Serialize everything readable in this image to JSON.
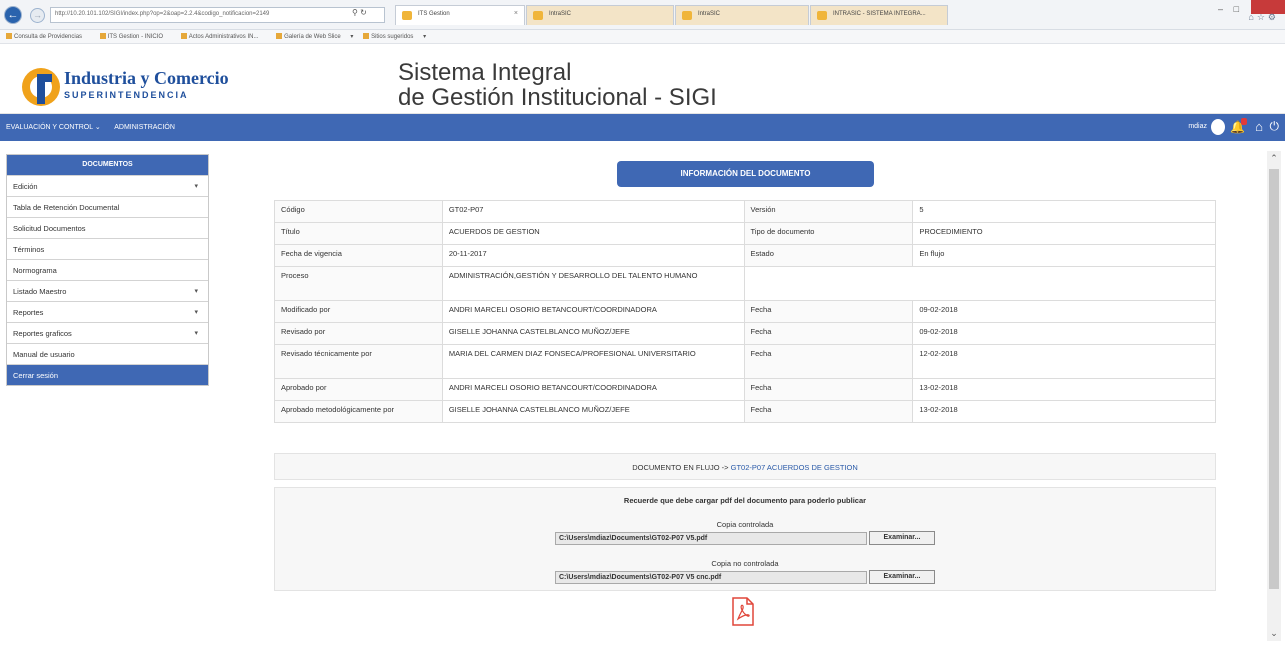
{
  "browser": {
    "url": "http://10.20.101.102/SIGI/index.php?op=2&oap=2.2.4&codigo_notificacion=2149",
    "tabs": [
      "ITS Gestion",
      "IntraSIC",
      "IntraSIC",
      "INTRASIC - SISTEMA INTEGRA..."
    ],
    "favorites": [
      "Consulta de Providencias",
      "ITS Gestion - INICIO",
      "Actos Administrativos IN...",
      "Galería de Web Slice",
      "Sitios sugeridos"
    ]
  },
  "header": {
    "org_name": "Industria y Comercio",
    "org_sub": "SUPERINTENDENCIA",
    "app_title_line1": "Sistema Integral",
    "app_title_line2": "de Gestión Institucional - SIGI"
  },
  "topnav": {
    "menu": [
      "EVALUACIÓN Y CONTROL ⌄",
      "ADMINISTRACIÓN"
    ],
    "user": "mdiaz"
  },
  "sidebar": {
    "title": "DOCUMENTOS",
    "items": [
      {
        "label": "Edición",
        "chevron": true
      },
      {
        "label": "Tabla de Retención Documental",
        "chevron": false
      },
      {
        "label": "Solicitud Documentos",
        "chevron": false
      },
      {
        "label": "Términos",
        "chevron": false
      },
      {
        "label": "Normograma",
        "chevron": false
      },
      {
        "label": "Listado Maestro",
        "chevron": true
      },
      {
        "label": "Reportes",
        "chevron": true
      },
      {
        "label": "Reportes graficos",
        "chevron": true
      },
      {
        "label": "Manual de usuario",
        "chevron": false
      },
      {
        "label": "Cerrar sesión",
        "chevron": false
      }
    ]
  },
  "main": {
    "info_button": "INFORMACIÓN DEL DOCUMENTO",
    "rows": [
      [
        "Código",
        "GT02-P07",
        "Versión",
        "5"
      ],
      [
        "Título",
        "ACUERDOS DE GESTION",
        "Tipo de documento",
        "PROCEDIMIENTO"
      ],
      [
        "Fecha de vigencia",
        "20-11-2017",
        "Estado",
        "En flujo"
      ],
      [
        "Proceso",
        "ADMINISTRACIÓN,GESTIÓN Y DESARROLLO DEL TALENTO HUMANO",
        "",
        ""
      ],
      [
        "Modificado por",
        "ANDRI MARCELI OSORIO BETANCOURT/COORDINADORA",
        "Fecha",
        "09-02-2018"
      ],
      [
        "Revisado por",
        "GISELLE JOHANNA CASTELBLANCO MUÑOZ/JEFE",
        "Fecha",
        "09-02-2018"
      ],
      [
        "Revisado técnicamente por",
        "MARIA DEL CARMEN DIAZ FONSECA/PROFESIONAL UNIVERSITARIO",
        "Fecha",
        "12-02-2018"
      ],
      [
        "Aprobado por",
        "ANDRI MARCELI OSORIO BETANCOURT/COORDINADORA",
        "Fecha",
        "13-02-2018"
      ],
      [
        "Aprobado metodológicamente por",
        "GISELLE JOHANNA CASTELBLANCO MUÑOZ/JEFE",
        "Fecha",
        "13-02-2018"
      ]
    ],
    "flow_prefix": "DOCUMENTO EN FLUJO -> ",
    "flow_link": "GT02-P07 ACUERDOS DE GESTION",
    "upload_note": "Recuerde que debe cargar pdf del documento para poderlo publicar",
    "controlled_label": "Copia controlada",
    "controlled_value": "C:\\Users\\mdiaz\\Documents\\GT02-P07 V5.pdf",
    "uncontrolled_label": "Copia no controlada",
    "uncontrolled_value": "C:\\Users\\mdiaz\\Documents\\GT02-P07 V5 cnc.pdf",
    "browse_label": "Examinar..."
  }
}
